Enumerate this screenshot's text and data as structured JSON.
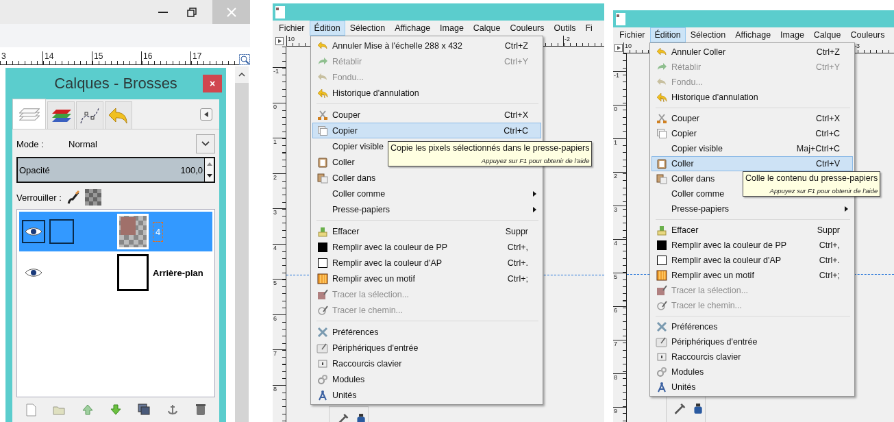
{
  "layers_window": {
    "ruler_labels": [
      "3",
      "14",
      "15",
      "16",
      "17"
    ],
    "dock": {
      "title": "Calques - Brosses",
      "close": "×",
      "tabs": [
        {
          "selected": true
        },
        {
          "selected": false
        },
        {
          "selected": false
        },
        {
          "selected": false
        }
      ],
      "mode": {
        "label": "Mode :",
        "value": "Normal"
      },
      "opacity": {
        "label": "Opacité",
        "value": "100,0",
        "level": 1
      },
      "lock": {
        "label": "Verrouiller :"
      },
      "layers": [
        {
          "name": "4",
          "selected": true,
          "visible": true,
          "editing": true
        },
        {
          "name": "Arrière-plan",
          "selected": false,
          "visible": true,
          "editing": false
        }
      ]
    }
  },
  "editor_windows": [
    {
      "menubar": [
        {
          "label": "Fichier",
          "selected": false
        },
        {
          "label": "Édition",
          "selected": true
        },
        {
          "label": "Sélection",
          "selected": false
        },
        {
          "label": "Affichage",
          "selected": false
        },
        {
          "label": "Image",
          "selected": false
        },
        {
          "label": "Calque",
          "selected": false
        },
        {
          "label": "Couleurs",
          "selected": false
        },
        {
          "label": "Outils",
          "selected": false
        },
        {
          "label": "Fi",
          "selected": false
        }
      ],
      "top_ruler": [
        "10",
        "-2"
      ],
      "side_ruler": [
        "-1",
        "0",
        "1",
        "2",
        "3",
        "4",
        "5",
        "6",
        "7",
        "8"
      ],
      "menu": [
        {
          "kind": "item",
          "label": "Annuler Mise à l'échelle 288 x 432",
          "shortcut": "Ctrl+Z",
          "disabled": false,
          "selected": false,
          "submenu": false
        },
        {
          "kind": "item",
          "label": "Rétablir",
          "shortcut": "Ctrl+Y",
          "disabled": true,
          "selected": false,
          "submenu": false
        },
        {
          "kind": "item",
          "label": "Fondu...",
          "disabled": true,
          "selected": false,
          "submenu": false
        },
        {
          "kind": "item",
          "label": "Historique d'annulation",
          "disabled": false,
          "selected": false,
          "submenu": false
        },
        {
          "kind": "separator"
        },
        {
          "kind": "item",
          "label": "Couper",
          "shortcut": "Ctrl+X",
          "disabled": false,
          "selected": false,
          "submenu": false
        },
        {
          "kind": "item",
          "label": "Copier",
          "shortcut": "Ctrl+C",
          "disabled": false,
          "selected": true,
          "submenu": false
        },
        {
          "kind": "item",
          "label": "Copier visible",
          "disabled": false,
          "selected": false,
          "submenu": false
        },
        {
          "kind": "item",
          "label": "Coller",
          "disabled": false,
          "selected": false,
          "submenu": false
        },
        {
          "kind": "item",
          "label": "Coller dans",
          "disabled": false,
          "selected": false,
          "submenu": false
        },
        {
          "kind": "item",
          "label": "Coller comme",
          "disabled": false,
          "selected": false,
          "submenu": true
        },
        {
          "kind": "item",
          "label": "Presse-papiers",
          "disabled": false,
          "selected": false,
          "submenu": true
        },
        {
          "kind": "separator"
        },
        {
          "kind": "item",
          "label": "Effacer",
          "shortcut": "Suppr",
          "disabled": false,
          "selected": false,
          "submenu": false
        },
        {
          "kind": "item",
          "label": "Remplir avec la couleur de PP",
          "shortcut": "Ctrl+,",
          "disabled": false,
          "selected": false,
          "submenu": false
        },
        {
          "kind": "item",
          "label": "Remplir avec la couleur d'AP",
          "shortcut": "Ctrl+.",
          "disabled": false,
          "selected": false,
          "submenu": false
        },
        {
          "kind": "item",
          "label": "Remplir avec un motif",
          "shortcut": "Ctrl+;",
          "disabled": false,
          "selected": false,
          "submenu": false
        },
        {
          "kind": "item",
          "label": "Tracer la sélection...",
          "disabled": true,
          "selected": false,
          "submenu": false
        },
        {
          "kind": "item",
          "label": "Tracer le chemin...",
          "disabled": true,
          "selected": false,
          "submenu": false
        },
        {
          "kind": "separator"
        },
        {
          "kind": "item",
          "label": "Préférences",
          "disabled": false,
          "selected": false,
          "submenu": false
        },
        {
          "kind": "item",
          "label": "Périphériques d'entrée",
          "disabled": false,
          "selected": false,
          "submenu": false
        },
        {
          "kind": "item",
          "label": "Raccourcis clavier",
          "disabled": false,
          "selected": false,
          "submenu": false
        },
        {
          "kind": "item",
          "label": "Modules",
          "disabled": false,
          "selected": false,
          "submenu": false
        },
        {
          "kind": "item",
          "label": "Unités",
          "disabled": false,
          "selected": false,
          "submenu": false
        }
      ],
      "tooltip": {
        "text": "Copie les pixels sélectionnés dans le presse-papiers",
        "hint": "Appuyez sur F1 pour obtenir de l'aide"
      }
    },
    {
      "menubar": [
        {
          "label": "Fichier",
          "selected": false
        },
        {
          "label": "Édition",
          "selected": true
        },
        {
          "label": "Sélection",
          "selected": false
        },
        {
          "label": "Affichage",
          "selected": false
        },
        {
          "label": "Image",
          "selected": false
        },
        {
          "label": "Calque",
          "selected": false
        },
        {
          "label": "Couleurs",
          "selected": false
        }
      ],
      "top_ruler": [
        "10",
        "-3"
      ],
      "side_ruler": [
        "-1",
        "0",
        "1",
        "2",
        "3",
        "4",
        "5",
        "6",
        "7",
        "8",
        "9"
      ],
      "menu": [
        {
          "kind": "item",
          "label": "Annuler Coller",
          "shortcut": "Ctrl+Z",
          "disabled": false,
          "selected": false,
          "submenu": false
        },
        {
          "kind": "item",
          "label": "Rétablir",
          "shortcut": "Ctrl+Y",
          "disabled": true,
          "selected": false,
          "submenu": false
        },
        {
          "kind": "item",
          "label": "Fondu...",
          "disabled": true,
          "selected": false,
          "submenu": false
        },
        {
          "kind": "item",
          "label": "Historique d'annulation",
          "disabled": false,
          "selected": false,
          "submenu": false
        },
        {
          "kind": "separator"
        },
        {
          "kind": "item",
          "label": "Couper",
          "shortcut": "Ctrl+X",
          "disabled": false,
          "selected": false,
          "submenu": false
        },
        {
          "kind": "item",
          "label": "Copier",
          "shortcut": "Ctrl+C",
          "disabled": false,
          "selected": false,
          "submenu": false
        },
        {
          "kind": "item",
          "label": "Copier visible",
          "shortcut": "Maj+Ctrl+C",
          "disabled": false,
          "selected": false,
          "submenu": false
        },
        {
          "kind": "item",
          "label": "Coller",
          "shortcut": "Ctrl+V",
          "disabled": false,
          "selected": true,
          "submenu": false
        },
        {
          "kind": "item",
          "label": "Coller dans",
          "disabled": false,
          "selected": false,
          "submenu": false
        },
        {
          "kind": "item",
          "label": "Coller comme",
          "disabled": false,
          "selected": false,
          "submenu": false
        },
        {
          "kind": "item",
          "label": "Presse-papiers",
          "disabled": false,
          "selected": false,
          "submenu": true
        },
        {
          "kind": "separator"
        },
        {
          "kind": "item",
          "label": "Effacer",
          "shortcut": "Suppr",
          "disabled": false,
          "selected": false,
          "submenu": false
        },
        {
          "kind": "item",
          "label": "Remplir avec la couleur de PP",
          "shortcut": "Ctrl+,",
          "disabled": false,
          "selected": false,
          "submenu": false
        },
        {
          "kind": "item",
          "label": "Remplir avec la couleur d'AP",
          "shortcut": "Ctrl+.",
          "disabled": false,
          "selected": false,
          "submenu": false
        },
        {
          "kind": "item",
          "label": "Remplir avec un motif",
          "shortcut": "Ctrl+;",
          "disabled": false,
          "selected": false,
          "submenu": false
        },
        {
          "kind": "item",
          "label": "Tracer la sélection...",
          "disabled": true,
          "selected": false,
          "submenu": false
        },
        {
          "kind": "item",
          "label": "Tracer le chemin...",
          "disabled": true,
          "selected": false,
          "submenu": false
        },
        {
          "kind": "separator"
        },
        {
          "kind": "item",
          "label": "Préférences",
          "disabled": false,
          "selected": false,
          "submenu": false
        },
        {
          "kind": "item",
          "label": "Périphériques d'entrée",
          "disabled": false,
          "selected": false,
          "submenu": false
        },
        {
          "kind": "item",
          "label": "Raccourcis clavier",
          "disabled": false,
          "selected": false,
          "submenu": false
        },
        {
          "kind": "item",
          "label": "Modules",
          "disabled": false,
          "selected": false,
          "submenu": false
        },
        {
          "kind": "item",
          "label": "Unités",
          "disabled": false,
          "selected": false,
          "submenu": false
        }
      ],
      "tooltip": {
        "text": "Colle le contenu du presse-papiers",
        "hint": "Appuyez sur F1 pour obtenir de l'aide"
      }
    }
  ]
}
